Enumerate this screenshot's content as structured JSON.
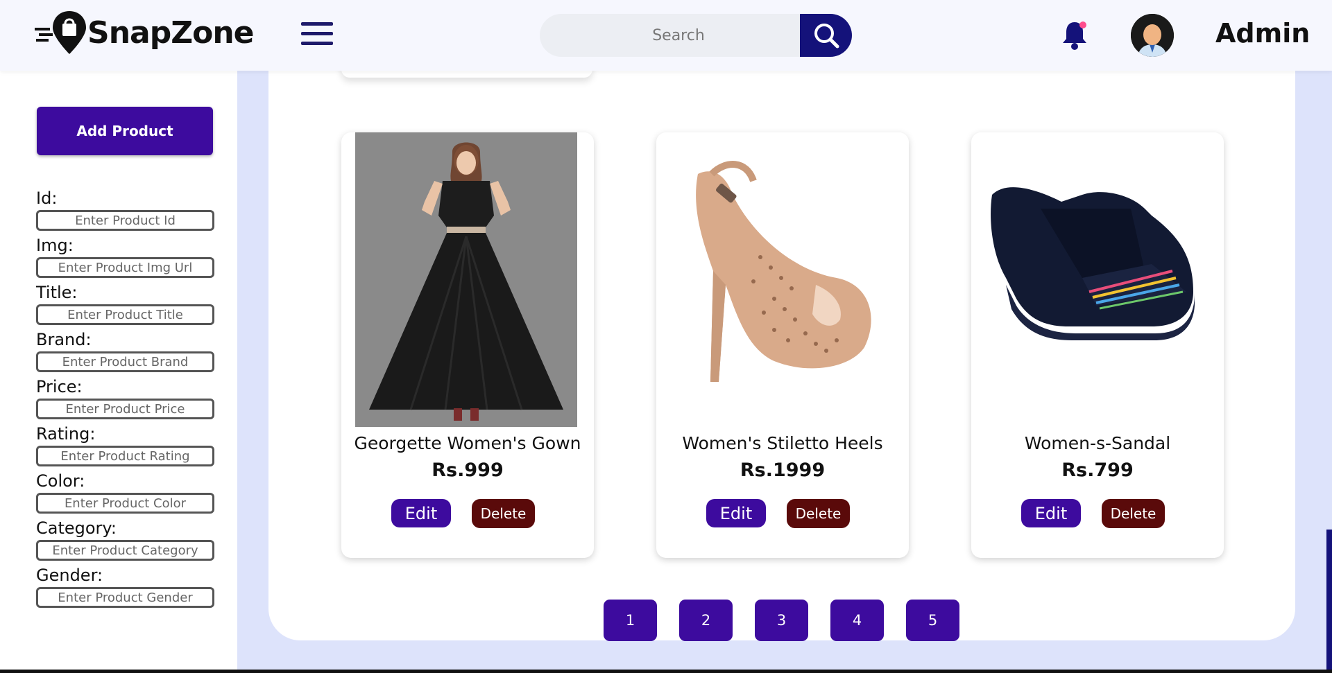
{
  "app": {
    "name": "SnapZone"
  },
  "search": {
    "placeholder": "Search"
  },
  "user": {
    "name": "Admin"
  },
  "sidebar": {
    "add_button": "Add Product",
    "fields": [
      {
        "label": "Id:",
        "placeholder": "Enter Product Id"
      },
      {
        "label": "Img:",
        "placeholder": "Enter Product Img Url"
      },
      {
        "label": "Title:",
        "placeholder": "Enter Product Title"
      },
      {
        "label": "Brand:",
        "placeholder": "Enter Product Brand"
      },
      {
        "label": "Price:",
        "placeholder": "Enter Product Price"
      },
      {
        "label": "Rating:",
        "placeholder": "Enter Product Rating"
      },
      {
        "label": "Color:",
        "placeholder": "Enter Product Color"
      },
      {
        "label": "Category:",
        "placeholder": "Enter Product Category"
      },
      {
        "label": "Gender:",
        "placeholder": "Enter Product Gender"
      }
    ]
  },
  "products": [
    {
      "title": "Georgette Women's Gown",
      "price": "Rs.999",
      "edit": "Edit",
      "delete": "Delete",
      "image": "black-gown-photo"
    },
    {
      "title": "Women's Stiletto Heels",
      "price": "Rs.1999",
      "edit": "Edit",
      "delete": "Delete",
      "image": "rose-gold-heel-photo"
    },
    {
      "title": "Women-s-Sandal",
      "price": "Rs.799",
      "edit": "Edit",
      "delete": "Delete",
      "image": "navy-wedge-sandal-photo"
    }
  ],
  "pagination": {
    "pages": [
      "1",
      "2",
      "3",
      "4",
      "5"
    ]
  },
  "colors": {
    "primary": "#3d0b9e",
    "danger": "#5a0a0a",
    "search_button": "#14127a",
    "background": "#dde3fb",
    "notification_dot": "#ff4d8d"
  }
}
